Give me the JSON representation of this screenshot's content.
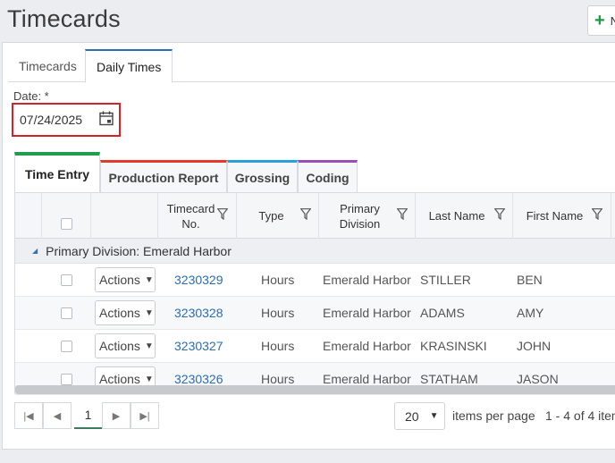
{
  "header": {
    "title": "Timecards",
    "new_button_icon": "plus-icon",
    "new_button_label": "N"
  },
  "top_tabs": [
    {
      "label": "Timecards",
      "active": false
    },
    {
      "label": "Daily Times",
      "active": true
    }
  ],
  "date": {
    "label": "Date: *",
    "value": "07/24/2025",
    "icon": "calendar-icon"
  },
  "sub_tabs": [
    {
      "label": "Time Entry",
      "color": "#1e9e4e",
      "active": true
    },
    {
      "label": "Production Report",
      "color": "#e03c2c",
      "active": false
    },
    {
      "label": "Grossing",
      "color": "#2ba0d8",
      "active": false
    },
    {
      "label": "Coding",
      "color": "#9a4fb4",
      "active": false
    }
  ],
  "grid": {
    "columns": [
      {
        "label": ""
      },
      {
        "label": ""
      },
      {
        "label": ""
      },
      {
        "label": "Timecard No.",
        "filter": true
      },
      {
        "label": "Type",
        "filter": true
      },
      {
        "label": "Primary Division",
        "filter": true
      },
      {
        "label": "Last Name",
        "filter": true
      },
      {
        "label": "First Name",
        "filter": true
      }
    ],
    "group_label": "Primary Division: Emerald Harbor",
    "actions_label": "Actions",
    "rows": [
      {
        "timecard_no": "3230329",
        "type": "Hours",
        "division": "Emerald Harbor",
        "last_name": "STILLER",
        "first_name": "BEN"
      },
      {
        "timecard_no": "3230328",
        "type": "Hours",
        "division": "Emerald Harbor",
        "last_name": "ADAMS",
        "first_name": "AMY"
      },
      {
        "timecard_no": "3230327",
        "type": "Hours",
        "division": "Emerald Harbor",
        "last_name": "KRASINSKI",
        "first_name": "JOHN"
      },
      {
        "timecard_no": "3230326",
        "type": "Hours",
        "division": "Emerald Harbor",
        "last_name": "STATHAM",
        "first_name": "JASON"
      }
    ]
  },
  "pager": {
    "current_page": "1",
    "page_size": "20",
    "items_per_page_label": "items per page",
    "range_text": "1 - 4 of 4 item"
  },
  "colors": {
    "accent_blue": "#2f6eae",
    "highlight_red": "#d3232a",
    "link": "#2a6db3"
  }
}
